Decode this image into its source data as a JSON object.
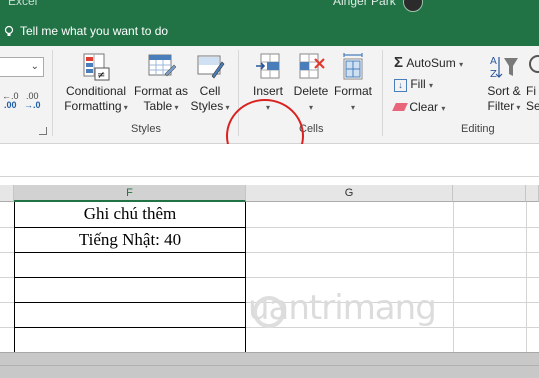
{
  "titlebar": {
    "app_name": "Excel",
    "user_name": "Ainger Park",
    "tell_me": "Tell me what you want to do"
  },
  "ribbon": {
    "number_format_value": "",
    "decimal_increase": ".00 →.0",
    "decimal_decrease": ".00 →.0",
    "styles": {
      "conditional_formatting": [
        "Conditional",
        "Formatting"
      ],
      "format_as_table": [
        "Format as",
        "Table"
      ],
      "cell_styles": [
        "Cell",
        "Styles"
      ],
      "group_label": "Styles"
    },
    "cells": {
      "insert": "Insert",
      "delete": "Delete",
      "format": "Format",
      "group_label": "Cells"
    },
    "editing": {
      "autosum": "AutoSum",
      "fill": "Fill",
      "clear": "Clear",
      "sort_filter": [
        "Sort &",
        "Filter"
      ],
      "find_select": [
        "Fi",
        "Se"
      ],
      "group_label": "Editing"
    },
    "highlight_color": "#d9211f"
  },
  "sheet": {
    "columns": [
      "F",
      "G"
    ],
    "active_column": "F",
    "cells": {
      "f1": "Ghi chú thêm",
      "f2": "Tiếng Nhật: 40"
    }
  },
  "watermark": "uantrimang"
}
